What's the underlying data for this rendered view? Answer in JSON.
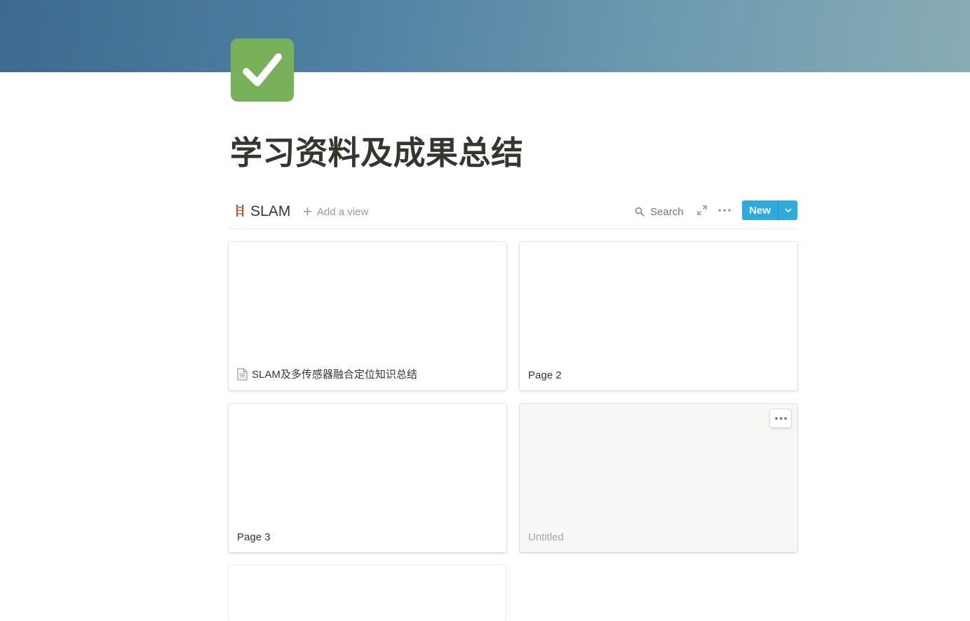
{
  "page": {
    "title": "学习资料及成果总结",
    "icon": "check-mark-button-icon",
    "icon_color": "#78b159",
    "cover_colors": [
      "#3d6a8e",
      "#88acb4"
    ]
  },
  "database": {
    "icon": "ladder-icon",
    "name": "SLAM",
    "add_view_label": "Add a view",
    "search_label": "Search",
    "new_label": "New",
    "accent": "#2eaadc"
  },
  "cards": [
    {
      "title": "SLAM及多传感器融合定位知识总结",
      "has_doc_icon": true
    },
    {
      "title": "Page 2"
    },
    {
      "title": "Page 3"
    },
    {
      "title": "Untitled",
      "placeholder": true
    }
  ]
}
